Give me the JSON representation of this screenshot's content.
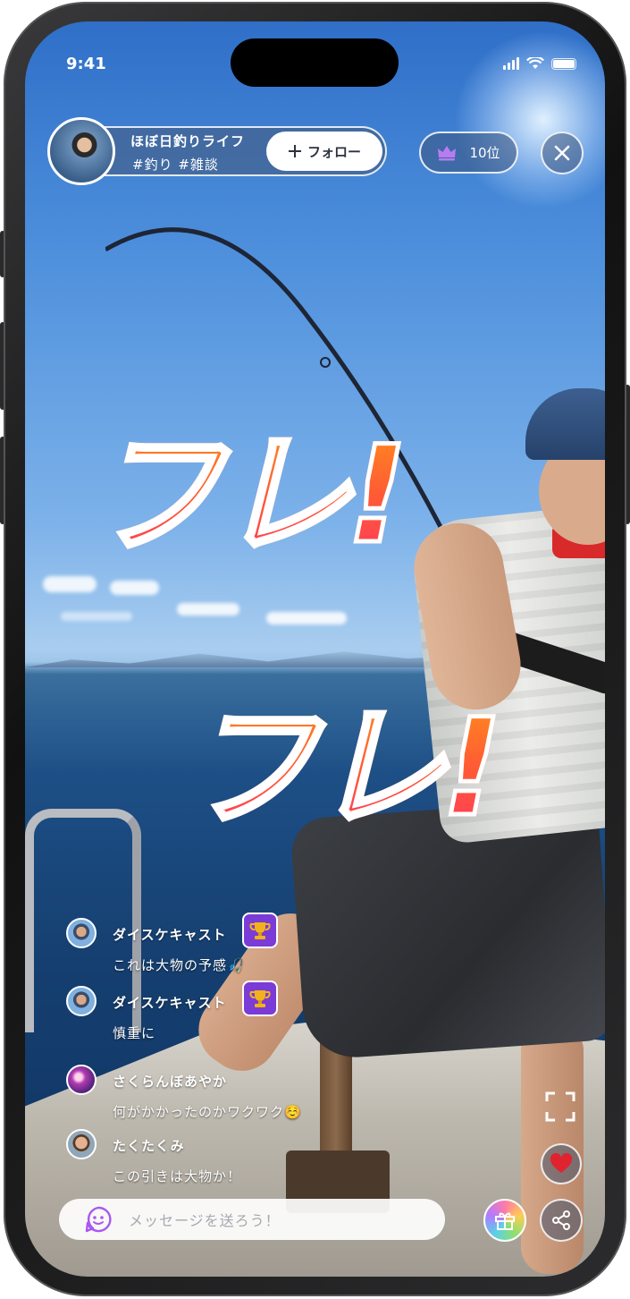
{
  "status_bar": {
    "time": "9:41"
  },
  "host": {
    "name": "ほぼ日釣りライフ",
    "tags": "#釣り #雑談",
    "follow_label": "フォロー",
    "follow_icon": "plus-icon"
  },
  "ranking": {
    "label": "10位",
    "icon": "crown-icon",
    "icon_color": "#b77cf0"
  },
  "cheer_texts": [
    "フレ!",
    "フレ!"
  ],
  "comments": [
    {
      "user": "ダイスケキャスト",
      "text": "これは大物の予感🎣",
      "badge": "trophy-icon"
    },
    {
      "user": "ダイスケキャスト",
      "text": "慎重に",
      "badge": "trophy-icon"
    },
    {
      "user": "さくらんぼあやか",
      "text": "何がかかったのかワクワク☺️"
    },
    {
      "user": "たくたくみ",
      "text": "この引きは大物か！"
    }
  ],
  "message_input": {
    "placeholder": "メッセージを送ろう！",
    "icon": "smile-icon"
  },
  "actions": {
    "expand_icon": "expand-icon",
    "like_icon": "heart-icon",
    "gift_icon": "gift-icon",
    "share_icon": "share-icon"
  },
  "colors": {
    "accent": "#7a3bd6",
    "heart": "#e0232e",
    "cheer_start": "#ff8a1e",
    "cheer_end": "#ff3a5c"
  }
}
